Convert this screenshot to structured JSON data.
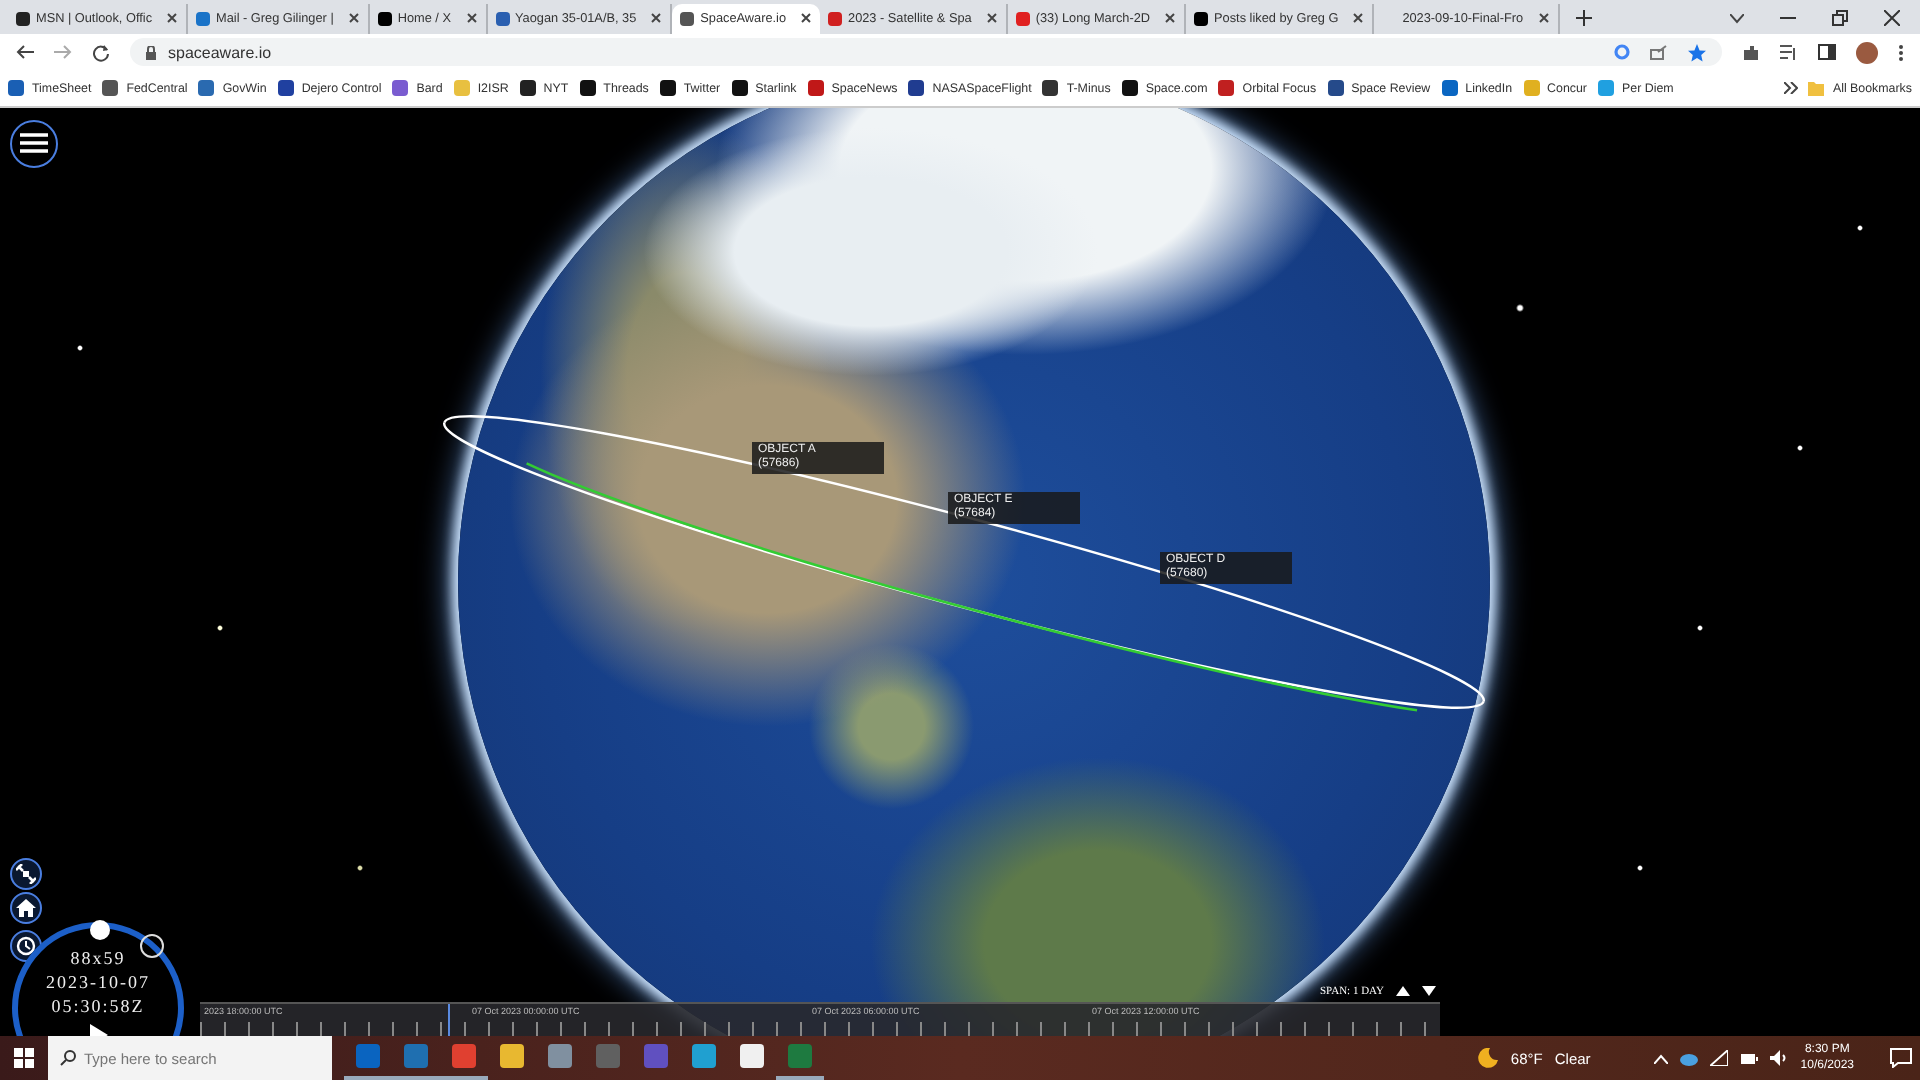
{
  "tabs": [
    {
      "title": "MSN | Outlook, Offic",
      "color": "#222222",
      "selected": false
    },
    {
      "title": "Mail - Greg Gilinger |",
      "color": "#1a73c8",
      "selected": false
    },
    {
      "title": "Home / X",
      "color": "#000000",
      "selected": false
    },
    {
      "title": "Yaogan 35-01A/B, 35",
      "color": "#2a5fb0",
      "selected": false
    },
    {
      "title": "SpaceAware.io",
      "color": "#555555",
      "selected": true
    },
    {
      "title": "2023 - Satellite & Spa",
      "color": "#d02020",
      "selected": false
    },
    {
      "title": "(33) Long March-2D",
      "color": "#e02020",
      "selected": false
    },
    {
      "title": "Posts liked by Greg G",
      "color": "#000000",
      "selected": false
    },
    {
      "title": "2023-09-10-Final-Fro",
      "selected": false
    }
  ],
  "address": "spaceaware.io",
  "bookmarks": [
    {
      "label": "TimeSheet",
      "color": "#1a5fb4"
    },
    {
      "label": "FedCentral",
      "color": "#555555"
    },
    {
      "label": "GovWin",
      "color": "#2a6ab0"
    },
    {
      "label": "Dejero Control",
      "color": "#2040a0"
    },
    {
      "label": "Bard",
      "color": "#7a5cd0"
    },
    {
      "label": "I2ISR",
      "color": "#e8c040"
    },
    {
      "label": "NYT",
      "color": "#222222"
    },
    {
      "label": "Threads",
      "color": "#111111"
    },
    {
      "label": "Twitter",
      "color": "#111111"
    },
    {
      "label": "Starlink",
      "color": "#111111"
    },
    {
      "label": "SpaceNews",
      "color": "#c01818"
    },
    {
      "label": "NASASpaceFlight",
      "color": "#203c90"
    },
    {
      "label": "T-Minus",
      "color": "#333333"
    },
    {
      "label": "Space.com",
      "color": "#111111"
    },
    {
      "label": "Orbital Focus",
      "color": "#c02020"
    },
    {
      "label": "Space Review",
      "color": "#254a8a"
    },
    {
      "label": "LinkedIn",
      "color": "#0a66c2"
    },
    {
      "label": "Concur",
      "color": "#e0b020"
    },
    {
      "label": "Per Diem",
      "color": "#20a0e0"
    }
  ],
  "all_bookmarks": "All Bookmarks",
  "scene": {
    "objects": [
      {
        "name": "OBJECT A",
        "number": "(57686)"
      },
      {
        "name": "OBJECT E",
        "number": "(57684)"
      },
      {
        "name": "OBJECT D",
        "number": "(57680)"
      }
    ],
    "clock": {
      "size": "88x59",
      "date": "2023-10-07",
      "time": "05:30:58Z"
    },
    "timeline": {
      "labels": [
        "2023 18:00:00 UTC",
        "07 Oct 2023 00:00:00 UTC",
        "07 Oct 2023 06:00:00 UTC",
        "07 Oct 2023 12:00:00 UTC"
      ],
      "level": 0.2
    },
    "span": "SPAN: 1 DAY"
  },
  "taskbar": {
    "search": {
      "placeholder": "Type here to search"
    },
    "apps": [
      {
        "color": "#0a64c0",
        "running": true
      },
      {
        "color": "#1f6fb0",
        "running": true
      },
      {
        "color": "#e04030",
        "running": true
      },
      {
        "color": "#e8b830",
        "running": false
      },
      {
        "color": "#8090a0",
        "running": false
      },
      {
        "color": "#606060",
        "running": false
      },
      {
        "color": "#6050c0",
        "running": false
      },
      {
        "color": "#20a0d0",
        "running": false
      },
      {
        "color": "#f0f0f0",
        "running": false
      },
      {
        "color": "#1e7a40",
        "running": true
      }
    ],
    "temperature": "68°F",
    "weather": "Clear",
    "time": "8:30 PM",
    "date": "10/6/2023"
  }
}
